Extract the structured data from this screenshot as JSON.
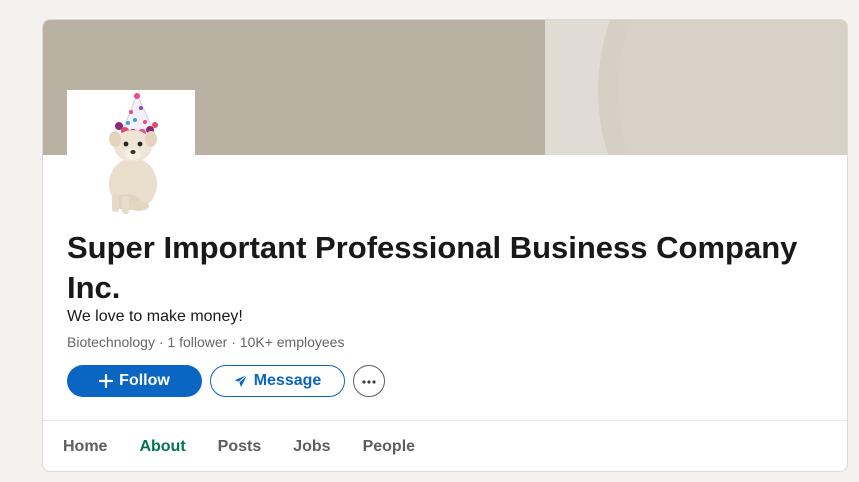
{
  "company": {
    "name": "Super Important Professional Business Company Inc.",
    "tagline": "We love to make money!",
    "industry": "Biotechnology",
    "followers": "1 follower",
    "employees": "10K+ employees",
    "separator": " · "
  },
  "actions": {
    "follow_label": "Follow",
    "message_label": "Message"
  },
  "tabs": [
    {
      "label": "Home",
      "active": false
    },
    {
      "label": "About",
      "active": true
    },
    {
      "label": "Posts",
      "active": false
    },
    {
      "label": "Jobs",
      "active": false
    },
    {
      "label": "People",
      "active": false
    }
  ],
  "colors": {
    "primary": "#0a66c2",
    "active_tab": "#01754f",
    "cover": "#b9b1a2"
  },
  "icons": {
    "follow": "plus-icon",
    "message": "send-icon",
    "more": "more-icon"
  }
}
